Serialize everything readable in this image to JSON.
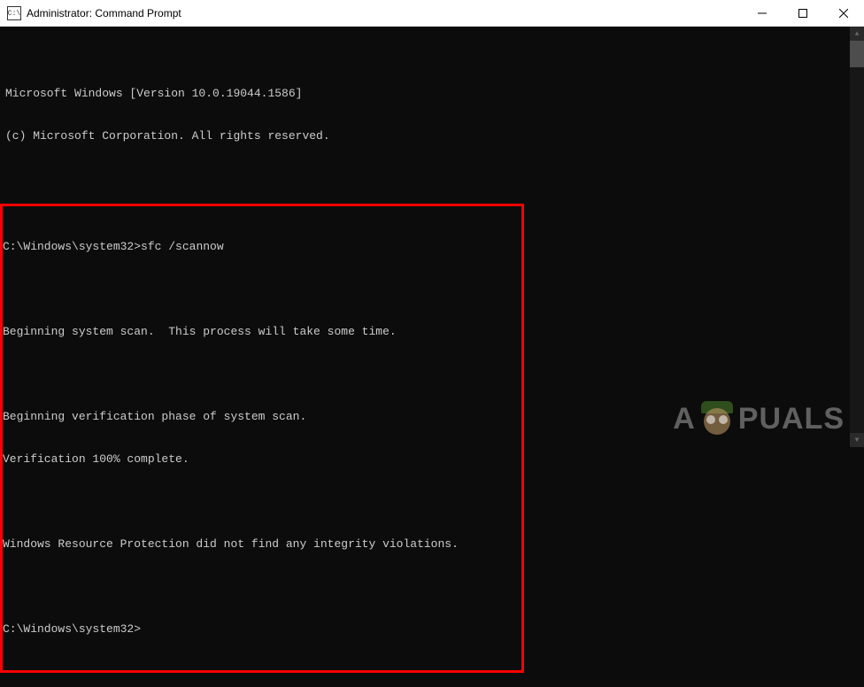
{
  "titlebar": {
    "icon_label": "C:\\",
    "title": "Administrator: Command Prompt"
  },
  "console": {
    "header_line1": "Microsoft Windows [Version 10.0.19044.1586]",
    "header_line2": "(c) Microsoft Corporation. All rights reserved.",
    "prompt1_path": "C:\\Windows\\system32>",
    "prompt1_cmd": "sfc /scannow",
    "out_line1": "Beginning system scan.  This process will take some time.",
    "out_line2": "Beginning verification phase of system scan.",
    "out_line3": "Verification 100% complete.",
    "out_line4": "Windows Resource Protection did not find any integrity violations.",
    "prompt2_path": "C:\\Windows\\system32>"
  },
  "watermark": {
    "left": "A",
    "right": "PUALS"
  }
}
